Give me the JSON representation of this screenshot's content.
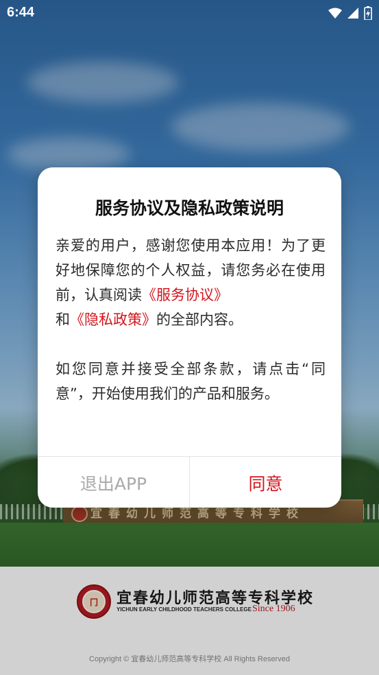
{
  "status_bar": {
    "time": "6:44",
    "icons": [
      "wifi-icon",
      "signal-icon",
      "battery-charging-icon"
    ]
  },
  "background": {
    "sign_text": "宜春幼儿师范高等专科学校",
    "colors": {
      "sky": "#3f80bf",
      "lawn": "#3f7a33"
    }
  },
  "footer": {
    "logo_cn": "宜春幼儿师范高等专科学校",
    "logo_en": "YICHUN EARLY CHILDHOOD TEACHERS COLLEGE",
    "logo_since": "Since 1906",
    "copyright": "Copyright © 宜春幼儿师范高等专科学校 All Rights Reserved"
  },
  "dialog": {
    "title": "服务协议及隐私政策说明",
    "p1_a": "亲爱的用户，感谢您使用本应用！为了更好地保障您的个人权益，请您务必在使用前，认真阅读",
    "link_service": "《服务协议》",
    "p1_b": "和",
    "link_privacy": "《隐私政策》",
    "p1_c": "的全部内容。",
    "p2": "如您同意并接受全部条款，请点击“同意”，开始使用我们的产品和服务。",
    "exit_label": "退出APP",
    "agree_label": "同意",
    "accent_color": "#d3141c"
  }
}
